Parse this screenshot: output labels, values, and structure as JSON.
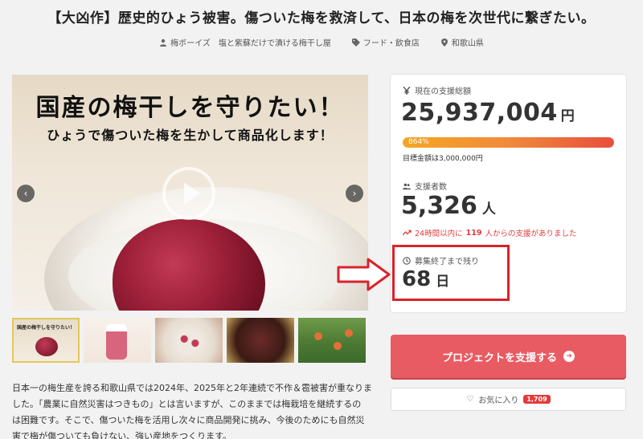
{
  "project": {
    "title": "【大凶作】歴史的ひょう被害。傷ついた梅を救済して、日本の梅を次世代に繋ぎたい。",
    "owner": "梅ボーイズ　塩と紫蘇だけで漬ける梅干し屋",
    "category": "フード・飲食店",
    "location": "和歌山県"
  },
  "hero": {
    "headline": "国産の梅干しを守りたい！",
    "subheadline": "ひょうで傷ついた梅を生かして商品化します！",
    "thumb_caption": "国産の梅干しを守りたい！"
  },
  "stats": {
    "total_label": "現在の支援総額",
    "total_amount": "25,937,004",
    "total_unit": "円",
    "progress_percent_label": "864%",
    "progress_fraction": 1.0,
    "goal_text": "目標金額は3,000,000円",
    "supporters_label": "支援者数",
    "supporters_count": "5,326",
    "supporters_unit": "人",
    "recent_prefix": "24時間以内に",
    "recent_count": "119",
    "recent_suffix": "人からの支援がありました",
    "remaining_label": "募集終了まで残り",
    "remaining_value": "68",
    "remaining_unit": "日"
  },
  "actions": {
    "support_label": "プロジェクトを支援する",
    "favorite_label": "お気に入り",
    "favorite_count": "1,709"
  },
  "description": {
    "line1": "日本一の梅生産を誇る和歌山県では2024年、2025年と2年連続で不作＆雹被害が重なりま",
    "line2": "した。「農業に自然災害はつきもの」とは言いますが、このままでは梅栽培を継続するの",
    "line3": "は困難です。そこで、傷ついた梅を活用し次々に商品開発に挑み、今後のためにも自然災",
    "line4": "害で梅が傷ついても負けない、強い産地をつくります。"
  },
  "colors": {
    "accent": "#e85b62",
    "alert": "#e33a3a",
    "annotation": "#d9232a"
  }
}
